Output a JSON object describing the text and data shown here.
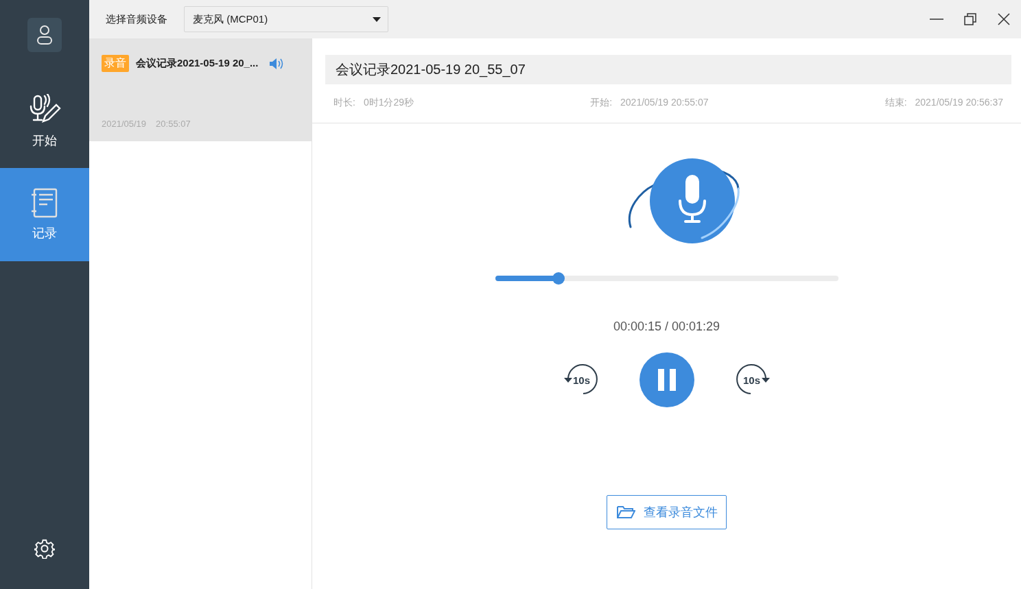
{
  "sidebar": {
    "nav": [
      {
        "label": "开始",
        "selected": false
      },
      {
        "label": "记录",
        "selected": true
      }
    ]
  },
  "toolbar": {
    "device_label": "选择音频设备",
    "device_value": "麦克风 (MCP01)"
  },
  "recordings": [
    {
      "tag": "录音",
      "title": "会议记录2021-05-19 20_...",
      "date": "2021/05/19",
      "time": "20:55:07",
      "selected": true,
      "playing": true
    }
  ],
  "detail": {
    "title": "会议记录2021-05-19 20_55_07",
    "meta": [
      {
        "label": "时长:",
        "value": "0时1分29秒"
      },
      {
        "label": "开始:",
        "value": "2021/05/19 20:55:07"
      },
      {
        "label": "结束:",
        "value": "2021/05/19 20:56:37"
      }
    ],
    "progress": {
      "level": 0.184
    },
    "time": "00:00:15 / 00:01:29",
    "rewind": "10s",
    "forward": "10s",
    "playing": true,
    "open_button": "查看录音文件"
  }
}
